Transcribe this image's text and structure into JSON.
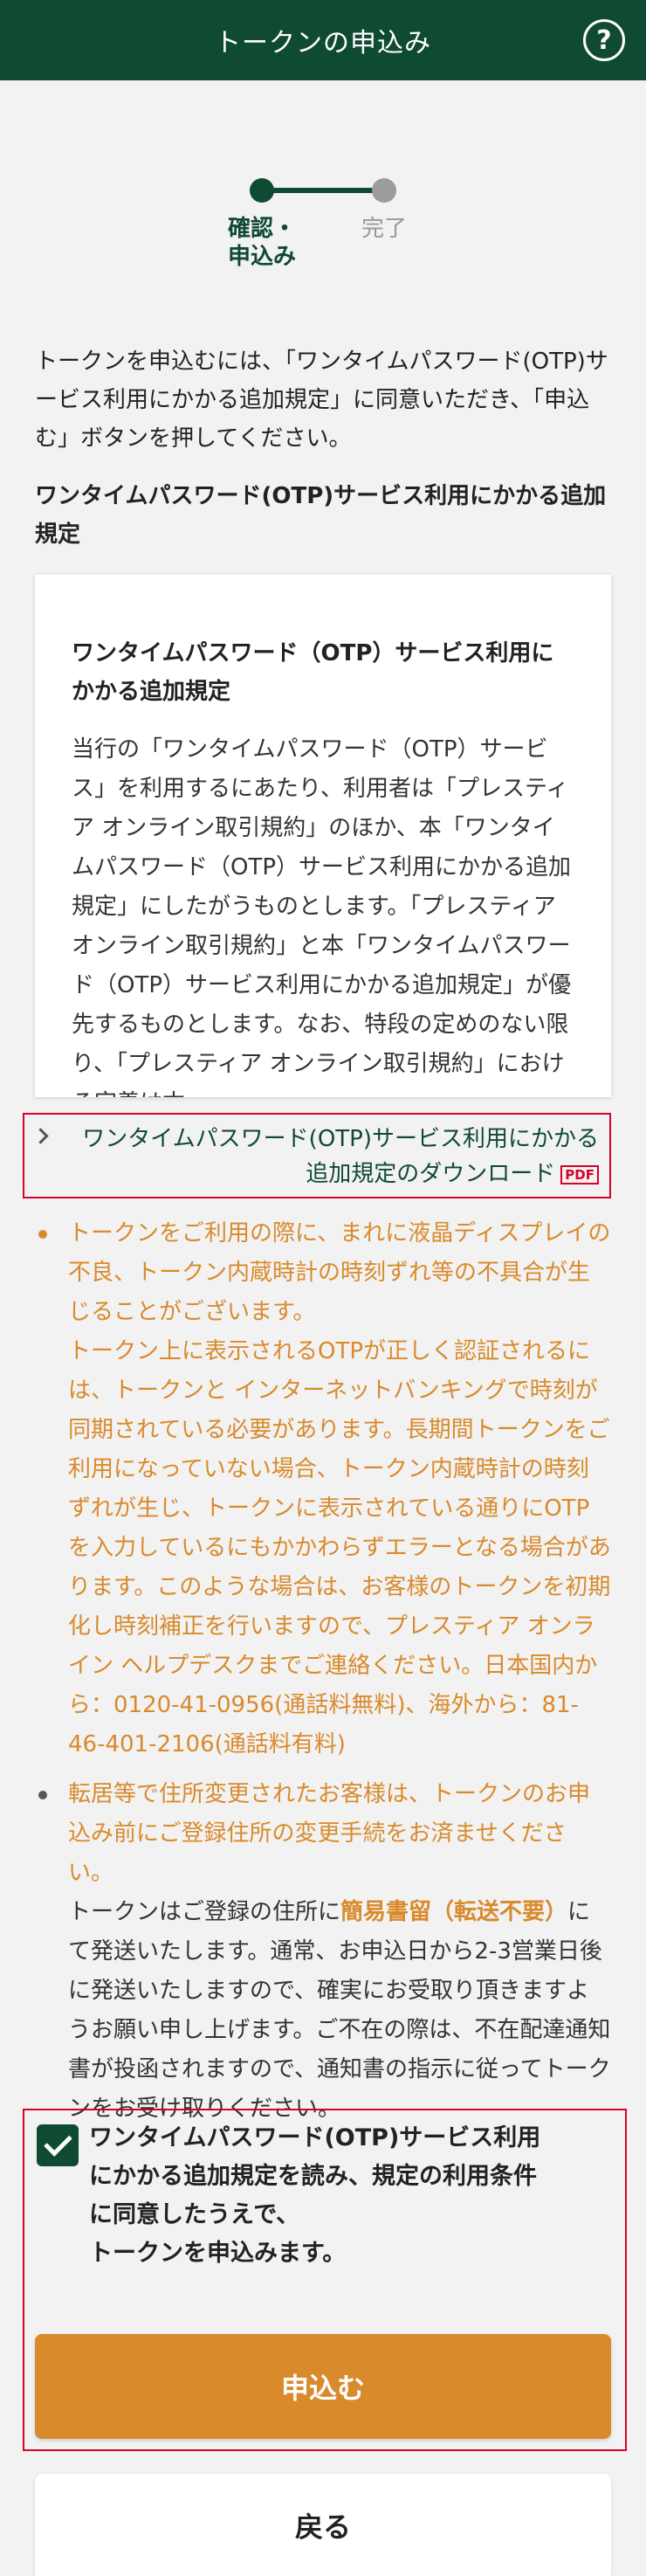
{
  "header": {
    "title": "トークンの申込み",
    "help_icon": "?"
  },
  "stepper": {
    "steps": [
      {
        "label_line1": "確認・",
        "label_line2": "申込み",
        "state": "current"
      },
      {
        "label_line1": "完了",
        "label_line2": "",
        "state": "upcoming"
      }
    ]
  },
  "intro": "トークンを申込むには、「ワンタイムパスワード(OTP)サービス利用にかかる追加規定」に同意いただき、「申込む」ボタンを押してください。",
  "section_title": "ワンタイムパスワード(OTP)サービス利用にかかる追加規定",
  "terms": {
    "heading": "ワンタイムパスワード（OTP）サービス利用にかかる追加規定",
    "body": "当行の「ワンタイムパスワード（OTP）サービス」を利用するにあたり、利用者は「プレスティア オンライン取引規約」のほか、本「ワンタイムパスワード（OTP）サービス利用にかかる追加規定」にしたがうものとします。「プレスティア オンライン取引規約」と本「ワンタイムパスワード（OTP）サービス利用にかかる追加規定」が優先するものとします。なお、特段の定めのない限り、「プレスティア オンライン取引規約」における定義は本"
  },
  "download": {
    "line1": "ワンタイムパスワード(OTP)サービス利用にかかる",
    "line2": "追加規定のダウンロード",
    "badge": "PDF"
  },
  "notices": {
    "item1_p1": "トークンをご利用の際に、まれに液晶ディスプレイの不良、トークン内蔵時計の時刻ずれ等の不具合が生じることがございます。",
    "item1_p2": "トークン上に表示されるOTPが正しく認証されるには、トークンと インターネットバンキングで時刻が同期されている必要があります。長期間トークンをご利用になっていない場合、トークン内蔵時計の時刻ずれが生じ、トークンに表示されている通りにOTPを入力しているにもかかわらずエラーとなる場合があります。このような場合は、お客様のトークンを初期化し時刻補正を行いますので、プレスティア オンライン ヘルプデスクまでご連絡ください。日本国内から：0120-41-0956(通話料無料)、海外から：81-46-401-2106(通話料有料)",
    "item2_p1": "転居等で住所変更されたお客様は、トークンのお申込み前にご登録住所の変更手続をお済ませください。",
    "item2_p2_before": "トークンはご登録の住所に",
    "item2_p2_highlight": "簡易書留（転送不要）",
    "item2_p2_after": "にて発送いたします。通常、お申込日から2-3営業日後に発送いたしますので、確実にお受取り頂きますようお願い申し上げます。ご不在の際は、不在配達通知書が投函されますので、通知書の指示に従ってトークンをお受け取りください。"
  },
  "agreement": {
    "checked": true,
    "line1": "ワンタイムパスワード(OTP)サービス利用",
    "line2": "にかかる追加規定を読み、規定の利用条件",
    "line3": "に同意したうえで、",
    "line4": "トークンを申込みます。"
  },
  "buttons": {
    "apply": "申込む",
    "back": "戻る"
  },
  "colors": {
    "header_bg": "#0f4a33",
    "accent_orange": "#d98a2b",
    "highlight_red": "#d9002b",
    "background": "#f2f2f2"
  }
}
